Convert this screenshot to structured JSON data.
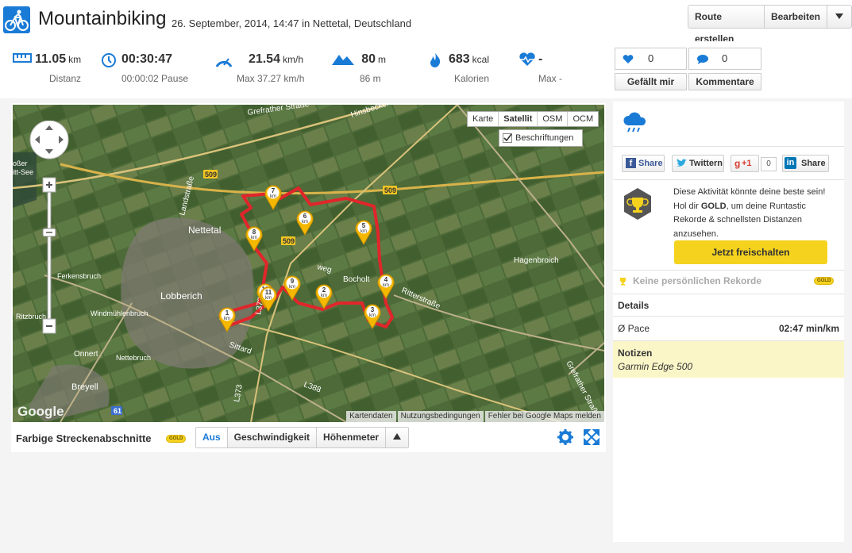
{
  "header": {
    "title": "Mountainbiking",
    "subtitle": "26. September, 2014, 14:47 in Nettetal, Deutschland",
    "buttons": [
      "Route erstellen",
      "Bearbeiten"
    ],
    "dropdown_icon": "triangle-down"
  },
  "stats": [
    {
      "icon": "ruler-icon",
      "value": "11.05",
      "unit": "km",
      "sub": "Distanz"
    },
    {
      "icon": "clock-icon",
      "value": "00:30:47",
      "unit": "",
      "sub": "00:00:02 Pause"
    },
    {
      "icon": "speedometer-icon",
      "value": "21.54",
      "unit": "km/h",
      "sub": "Max 37.27 km/h"
    },
    {
      "icon": "mountain-icon",
      "value": "80",
      "unit": "m",
      "sub": "86 m"
    },
    {
      "icon": "flame-icon",
      "value": "683",
      "unit": "kcal",
      "sub": "Kalorien"
    },
    {
      "icon": "heartrate-icon",
      "value": "-",
      "unit": "",
      "sub": "Max -"
    }
  ],
  "social_counts": {
    "likes": "0",
    "comments": "0",
    "like_label": "Gefällt mir",
    "comment_label": "Kommentare"
  },
  "map": {
    "types": [
      "Karte",
      "Satellit",
      "OSM",
      "OCM"
    ],
    "selected_type": "Satellit",
    "labels_checkbox": "Beschriftungen",
    "attribution": [
      "Kartendaten",
      "Nutzungsbedingungen",
      "Fehler bei Google Maps melden"
    ],
    "logo": "Google",
    "place_labels": [
      "Nettetal",
      "Lobberich",
      "Hagenbroich",
      "Ferkensbruch",
      "Windmühlenbruch",
      "Nettebruch",
      "Onnert",
      "Breyell",
      "Ritzbruch",
      "Grefrather Straße",
      "Hinsbecker Straße",
      "Landstraße",
      "Bocholt",
      "Ritterstraße",
      "Sittard",
      "Grefrather Straße",
      "L373",
      "L388",
      "509",
      "509",
      "509",
      "61",
      "oßer\nitt-See",
      "weg"
    ],
    "km_markers": [
      "1",
      "2",
      "3",
      "4",
      "5",
      "6",
      "7",
      "8",
      "9",
      "10",
      "11"
    ],
    "marker_unit": "km",
    "route_color": "#e0262b"
  },
  "map_footer": {
    "label": "Farbige Streckenabschnitte",
    "badge": "GOLD",
    "segments": [
      "Aus",
      "Geschwindigkeit",
      "Höhenmeter"
    ],
    "selected_segment": "Aus"
  },
  "side": {
    "weather_icon": "cloud-rain-icon",
    "share_buttons": [
      {
        "label": "Share",
        "icon": "facebook-icon"
      },
      {
        "label": "Twittern",
        "icon": "twitter-icon"
      },
      {
        "label": "+1",
        "icon": "googleplus-icon",
        "count": "0"
      },
      {
        "label": "Share",
        "icon": "linkedin-icon"
      }
    ],
    "promo_text_1": "Diese Aktivität könnte deine beste sein! Hol dir ",
    "promo_bold": "GOLD",
    "promo_text_2": ", um deine Runtastic Rekorde & schnellsten Distanzen anzusehen.",
    "promo_button": "Jetzt freischalten",
    "records_label": "Keine persönlichen Rekorde",
    "records_badge": "GOLD",
    "details_heading": "Details",
    "pace_label": "Ø Pace",
    "pace_value": "02:47 min/km",
    "notes_heading": "Notizen",
    "notes_text": "Garmin Edge 500"
  },
  "colors": {
    "accent_blue": "#1a7bd6",
    "gold": "#f5d21e",
    "notes_bg": "#fbf6c8"
  }
}
